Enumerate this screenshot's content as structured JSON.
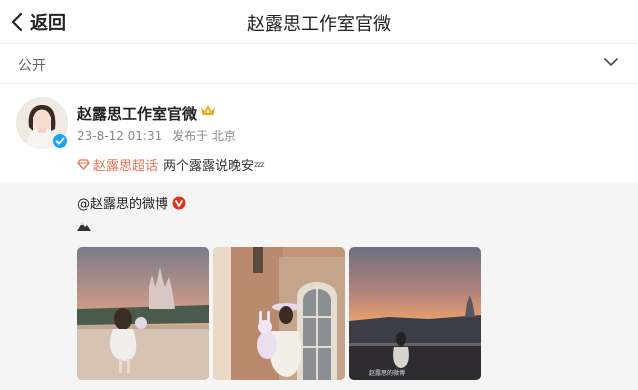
{
  "header": {
    "back_label": "返回",
    "title": "赵露思工作室官微"
  },
  "visibility": {
    "label": "公开"
  },
  "post": {
    "author_name": "赵露思工作室官微",
    "date": "23-8-12 01:31",
    "location": "发布于 北京",
    "topic": "赵露思超话",
    "text": "两个露露说晚安",
    "zzz": "zzz"
  },
  "repost": {
    "author": "@赵露思的微博",
    "images": [
      {
        "label": "photo-castle-sunset"
      },
      {
        "label": "photo-window-bunny"
      },
      {
        "label": "photo-sunset-railing"
      }
    ],
    "watermark": "赵露思的微博"
  },
  "colors": {
    "topic": "#eb7350",
    "verified_badge": "#1da1f2",
    "repost_bg": "#f5f5f5",
    "crown": "#f5a623",
    "red_v": "#e0331c"
  }
}
